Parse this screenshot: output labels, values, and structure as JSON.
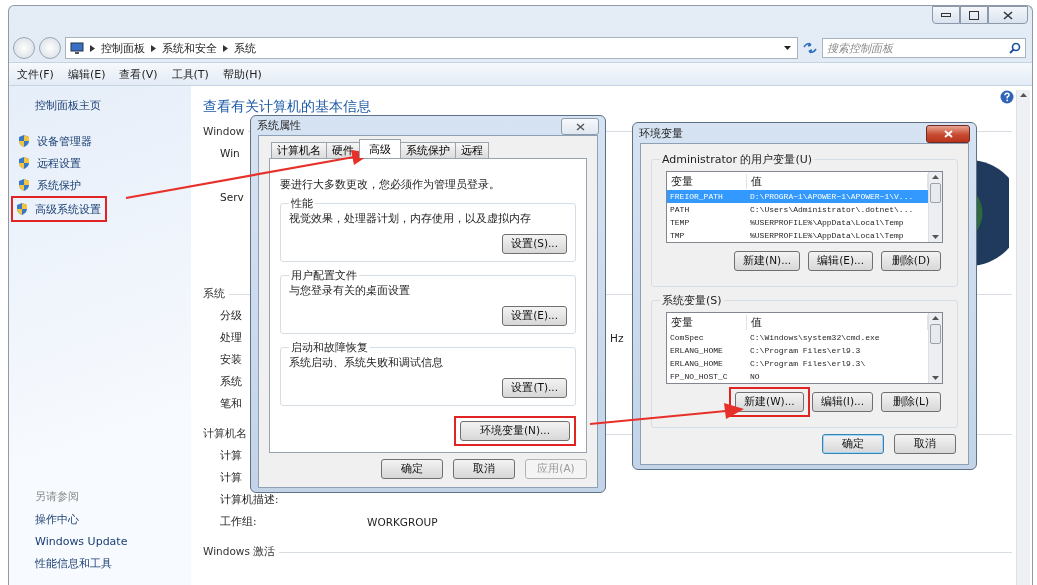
{
  "address_bar": {
    "breadcrumb": [
      "控制面板",
      "系统和安全",
      "系统"
    ],
    "search": {
      "placeholder": "搜索控制面板"
    }
  },
  "menu_bar": [
    "文件(F)",
    "编辑(E)",
    "查看(V)",
    "工具(T)",
    "帮助(H)"
  ],
  "sidebar": {
    "home": "控制面板主页",
    "items": [
      {
        "label": "设备管理器",
        "annotated": false
      },
      {
        "label": "远程设置",
        "annotated": false
      },
      {
        "label": "系统保护",
        "annotated": false
      },
      {
        "label": "高级系统设置",
        "annotated": true
      }
    ],
    "see_also": {
      "title": "另请参阅",
      "links": [
        "操作中心",
        "Windows Update",
        "性能信息和工具"
      ]
    }
  },
  "content": {
    "title": "查看有关计算机的基本信息",
    "sections": [
      {
        "title": "Window",
        "items": [
          {
            "label": "Win"
          },
          {
            "label": "Serv"
          }
        ]
      },
      {
        "title": "系统",
        "items": [
          {
            "label": "分级"
          },
          {
            "label": "处理",
            "tail": "Hz"
          },
          {
            "label": "安装"
          },
          {
            "label": "系统"
          },
          {
            "label": "笔和"
          }
        ]
      },
      {
        "title": "计算机名",
        "items": [
          {
            "label": "计算"
          },
          {
            "label": "计算"
          },
          {
            "label": "计算机描述:"
          },
          {
            "label": "工作组:",
            "value": "WORKGROUP"
          }
        ]
      },
      {
        "title": "Windows 激活"
      }
    ]
  },
  "system_properties": {
    "title": "系统属性",
    "tabs": [
      {
        "label": "计算机名",
        "selected": false
      },
      {
        "label": "硬件",
        "selected": false
      },
      {
        "label": "高级",
        "selected": true
      },
      {
        "label": "系统保护",
        "selected": false
      },
      {
        "label": "远程",
        "selected": false
      }
    ],
    "note": "要进行大多数更改，您必须作为管理员登录。",
    "groups": [
      {
        "title": "性能",
        "description": "视觉效果，处理器计划，内存使用，以及虚拟内存",
        "button": "设置(S)..."
      },
      {
        "title": "用户配置文件",
        "description": "与您登录有关的桌面设置",
        "button": "设置(E)..."
      },
      {
        "title": "启动和故障恢复",
        "description": "系统启动、系统失败和调试信息",
        "button": "设置(T)..."
      }
    ],
    "env_button": {
      "label": "环境变量(N)...",
      "annotated": true
    },
    "buttons": [
      {
        "label": "确定",
        "disabled": false
      },
      {
        "label": "取消",
        "disabled": false
      },
      {
        "label": "应用(A)",
        "disabled": true
      }
    ]
  },
  "environment_variables": {
    "title": "环境变量",
    "user_variables": {
      "title": "Administrator 的用户变量(U)",
      "columns": [
        "变量",
        "值"
      ],
      "rows": [
        {
          "name": "FREIOR_PATH",
          "value": "D:\\PROGRA~1\\APOWER~1\\APOWER~1\\V...",
          "selected": true
        },
        {
          "name": "PATH",
          "value": "C:\\Users\\Administrator\\.dotnet\\...",
          "selected": false
        },
        {
          "name": "TEMP",
          "value": "%USERPROFILE%\\AppData\\Local\\Temp",
          "selected": false
        },
        {
          "name": "TMP",
          "value": "%USERPROFILE%\\AppData\\Local\\Temp",
          "selected": false
        }
      ],
      "buttons": [
        {
          "label": "新建(N)...",
          "annotated": false
        },
        {
          "label": "编辑(E)...",
          "annotated": false
        },
        {
          "label": "删除(D)",
          "annotated": false
        }
      ]
    },
    "system_variables": {
      "title": "系统变量(S)",
      "columns": [
        "变量",
        "值"
      ],
      "rows": [
        {
          "name": "ComSpec",
          "value": "C:\\Windows\\system32\\cmd.exe",
          "selected": false
        },
        {
          "name": "ERLANG_HOME",
          "value": "C:\\Program Files\\erl9.3",
          "selected": false
        },
        {
          "name": "ERLANG_HOME",
          "value": "C:\\Program Files\\erl9.3\\",
          "selected": false
        },
        {
          "name": "FP_NO_HOST_C",
          "value": "NO",
          "selected": false
        }
      ],
      "buttons": [
        {
          "label": "新建(W)...",
          "annotated": true
        },
        {
          "label": "编辑(I)...",
          "annotated": false
        },
        {
          "label": "删除(L)",
          "annotated": false
        }
      ]
    },
    "buttons": [
      {
        "label": "确定",
        "default": true
      },
      {
        "label": "取消",
        "default": false
      }
    ]
  }
}
